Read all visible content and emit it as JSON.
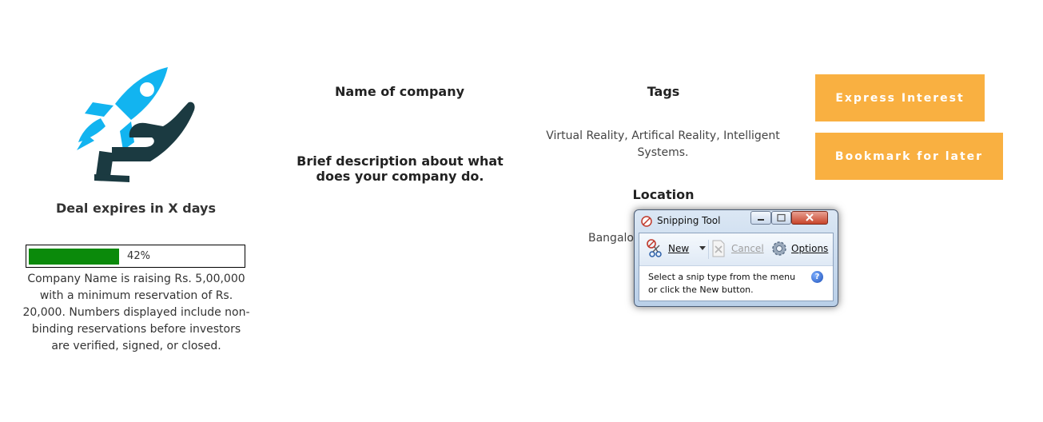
{
  "deal": {
    "expires": "Deal expires in X days",
    "progress_label": "42%",
    "progress_fraction": 0.42,
    "raising_text": "Company Name is raising Rs. 5,00,000 with a minimum reservation of Rs. 20,000. Numbers displayed include non-binding reservations before investors are verified, signed, or closed."
  },
  "company": {
    "name_heading": "Name of company",
    "description": "Brief description about what does your company do."
  },
  "tags": {
    "heading": "Tags",
    "value": "Virtual Reality, Artifical Reality, Intelligent Systems."
  },
  "location": {
    "heading": "Location",
    "value": "Bangalo"
  },
  "actions": {
    "express_label": "Express Interest",
    "bookmark_label": "Bookmark for later"
  },
  "snipping_tool": {
    "title": "Snipping Tool",
    "new_label": "New",
    "cancel_label": "Cancel",
    "options_label": "Options",
    "message_line1": "Select a snip type from the menu",
    "message_line2": "or click the New button.",
    "help_glyph": "?"
  },
  "colors": {
    "accent": "#f9b041",
    "progress": "#0b8a0b",
    "logo_blue": "#12b4f0",
    "logo_dark": "#1b3a41"
  },
  "icons": [
    "rocket-hand-logo",
    "snipping-tool-icon",
    "scissors-icon",
    "cancel-icon",
    "gear-icon",
    "help-icon"
  ]
}
